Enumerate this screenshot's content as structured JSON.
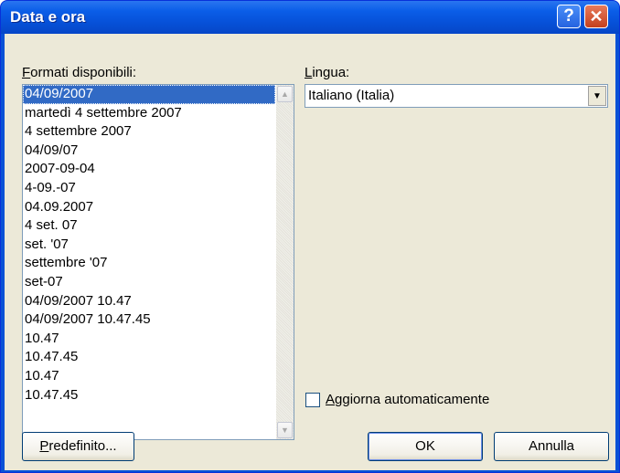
{
  "window": {
    "title": "Data e ora"
  },
  "titlebar": {
    "help_glyph": "?",
    "close_glyph": "✕"
  },
  "formats": {
    "label": "Formati disponibili:",
    "items": [
      "04/09/2007",
      "martedì 4 settembre 2007",
      "4 settembre 2007",
      "04/09/07",
      "2007-09-04",
      "4-09.-07",
      "04.09.2007",
      "4 set. 07",
      "set. '07",
      "settembre '07",
      "set-07",
      "04/09/2007 10.47",
      "04/09/2007 10.47.45",
      "10.47",
      "10.47.45",
      "10.47",
      "10.47.45"
    ],
    "selected_index": 0,
    "scroll_up_icon": "scroll-up-arrow",
    "scroll_down_icon": "scroll-down-arrow"
  },
  "language": {
    "label": "Lingua:",
    "value": "Italiano (Italia)",
    "dropdown_icon": "chevron-down"
  },
  "auto_update": {
    "label": "Aggiorna automaticamente",
    "checked": false
  },
  "buttons": {
    "default": "Predefinito...",
    "ok": "OK",
    "cancel": "Annulla"
  },
  "colors": {
    "titlebar": "#0b5ee8",
    "dialog_bg": "#ece9d8",
    "selection": "#316ac5",
    "close": "#c4401e"
  }
}
